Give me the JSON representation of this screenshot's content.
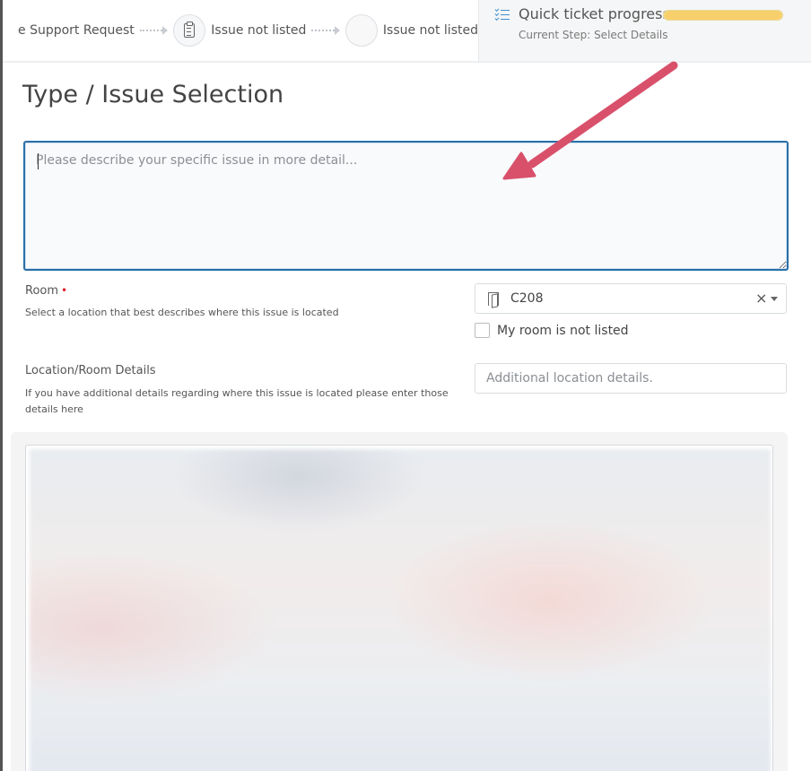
{
  "steps": [
    {
      "label": "e Support Request"
    },
    {
      "label": "Issue not listed",
      "icon": "clipboard-icon"
    },
    {
      "label": "Issue not listed",
      "icon": "empty-circle"
    }
  ],
  "progress": {
    "title": "Quick ticket progress",
    "current_step": "Current Step: Select Details",
    "fill_percent": 100,
    "icon": "checklist-icon",
    "color": "#f8d06b"
  },
  "page": {
    "title": "Type / Issue Selection"
  },
  "description": {
    "placeholder": "Please describe your specific issue in more detail...",
    "value": ""
  },
  "room": {
    "label": "Room",
    "required_mark": "•",
    "help": "Select a location that best describes where this issue is located",
    "selected": "C208",
    "icon": "door-icon",
    "clear_symbol": "×",
    "not_listed_label": "My room is not listed",
    "not_listed_checked": false
  },
  "location_details": {
    "label": "Location/Room Details",
    "help": "If you have additional details regarding where this issue is located please enter those details here",
    "placeholder": "Additional location details.",
    "value": ""
  },
  "colors": {
    "focus_border": "#2a6fa8",
    "required": "#e0222b",
    "annotation_arrow": "#d9506b",
    "accent_icon": "#3d8fd1"
  }
}
